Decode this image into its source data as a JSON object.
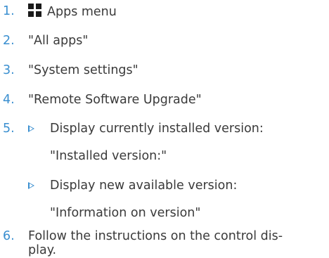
{
  "steps": [
    {
      "number": "1.",
      "text": "Apps menu",
      "icon": "apps-grid-icon"
    },
    {
      "number": "2.",
      "text": "\"All apps\""
    },
    {
      "number": "3.",
      "text": "\"System settings\""
    },
    {
      "number": "4.",
      "text": "\"Remote Software Upgrade\""
    },
    {
      "number": "5.",
      "bullets": [
        {
          "label": "Display currently installed version:",
          "value": "\"Installed version:\""
        },
        {
          "label": "Display new available version:",
          "value": "\"Information on version\""
        }
      ]
    },
    {
      "number": "6.",
      "text_line1": "Follow the instructions on the control dis-",
      "text_line2": "play."
    }
  ],
  "colors": {
    "number": "#3a8fd0",
    "text": "#3a3a3a",
    "icon": "#1a1a1a"
  }
}
